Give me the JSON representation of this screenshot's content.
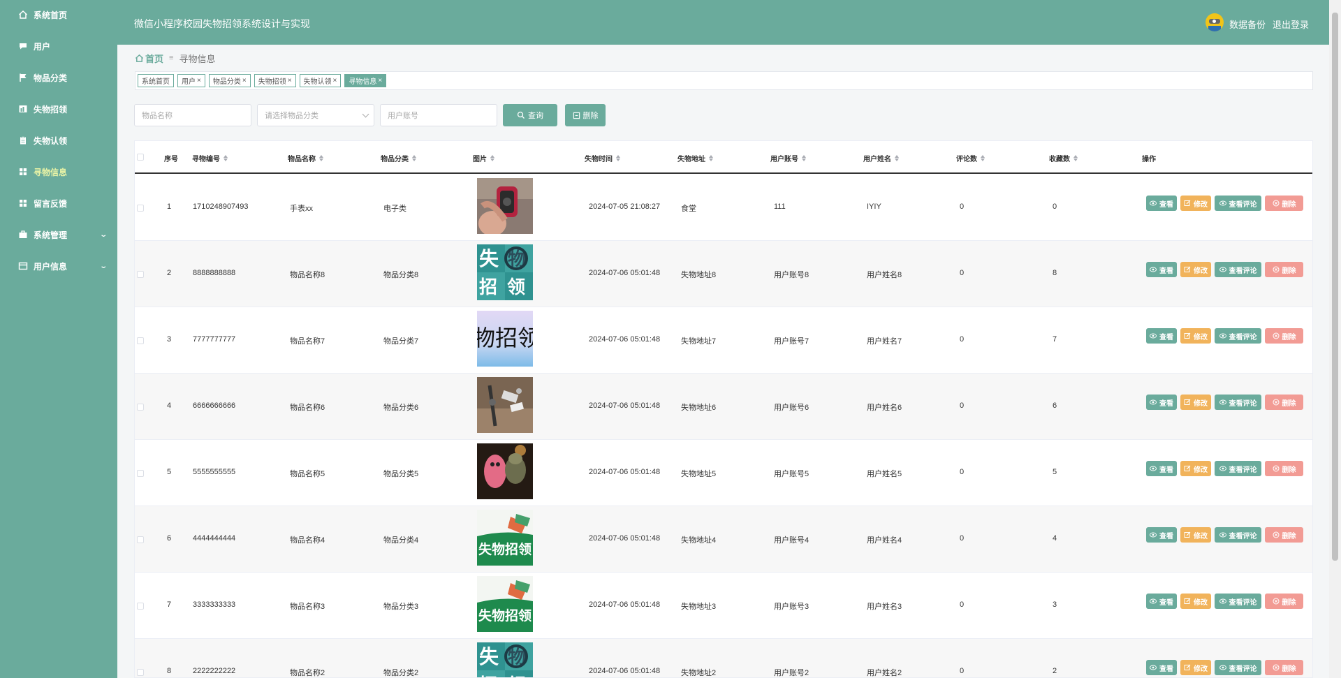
{
  "header": {
    "title": "微信小程序校园失物招领系统设计与实现",
    "backup_label": "数据备份",
    "logout_label": "退出登录"
  },
  "sidebar": {
    "items": [
      {
        "label": "系统首页",
        "icon": "home-icon"
      },
      {
        "label": "用户",
        "icon": "comment-icon"
      },
      {
        "label": "物品分类",
        "icon": "flag-icon"
      },
      {
        "label": "失物招领",
        "icon": "chart-icon"
      },
      {
        "label": "失物认领",
        "icon": "clipboard-icon"
      },
      {
        "label": "寻物信息",
        "icon": "grid-icon"
      },
      {
        "label": "留言反馈",
        "icon": "grid-icon"
      },
      {
        "label": "系统管理",
        "icon": "briefcase-icon"
      },
      {
        "label": "用户信息",
        "icon": "card-icon"
      }
    ]
  },
  "breadcrumb": {
    "home": "首页",
    "current": "寻物信息"
  },
  "tags": [
    {
      "label": "系统首页",
      "closable": false
    },
    {
      "label": "用户",
      "closable": true
    },
    {
      "label": "物品分类",
      "closable": true
    },
    {
      "label": "失物招领",
      "closable": true
    },
    {
      "label": "失物认领",
      "closable": true
    },
    {
      "label": "寻物信息",
      "closable": true
    }
  ],
  "search": {
    "name_placeholder": "物品名称",
    "category_placeholder": "请选择物品分类",
    "account_placeholder": "用户账号",
    "query_label": "查询",
    "delete_label": "删除"
  },
  "table": {
    "columns": [
      "序号",
      "寻物编号",
      "物品名称",
      "物品分类",
      "图片",
      "失物时间",
      "失物地址",
      "用户账号",
      "用户姓名",
      "评论数",
      "收藏数",
      "操作"
    ],
    "rows": [
      {
        "index": "1",
        "code": "1710248907493",
        "name": "手表xx",
        "category": "电子类",
        "time": "2024-07-05 21:08:27",
        "address": "食堂",
        "account": "111",
        "username": "IYIY",
        "comments": "0",
        "favorites": "0",
        "image": "watch"
      },
      {
        "index": "2",
        "code": "8888888888",
        "name": "物品名称8",
        "category": "物品分类8",
        "time": "2024-07-06 05:01:48",
        "address": "失物地址8",
        "account": "用户账号8",
        "username": "用户姓名8",
        "comments": "0",
        "favorites": "8",
        "image": "lost-found-teal"
      },
      {
        "index": "3",
        "code": "7777777777",
        "name": "物品名称7",
        "category": "物品分类7",
        "time": "2024-07-06 05:01:48",
        "address": "失物地址7",
        "account": "用户账号7",
        "username": "用户姓名7",
        "comments": "0",
        "favorites": "7",
        "image": "lost-found-text"
      },
      {
        "index": "4",
        "code": "6666666666",
        "name": "物品名称6",
        "category": "物品分类6",
        "time": "2024-07-06 05:01:48",
        "address": "失物地址6",
        "account": "用户账号6",
        "username": "用户姓名6",
        "comments": "0",
        "favorites": "6",
        "image": "keys"
      },
      {
        "index": "5",
        "code": "5555555555",
        "name": "物品名称5",
        "category": "物品分类5",
        "time": "2024-07-06 05:01:48",
        "address": "失物地址5",
        "account": "用户账号5",
        "username": "用户姓名5",
        "comments": "0",
        "favorites": "5",
        "image": "toys"
      },
      {
        "index": "6",
        "code": "4444444444",
        "name": "物品名称4",
        "category": "物品分类4",
        "time": "2024-07-06 05:01:48",
        "address": "失物地址4",
        "account": "用户账号4",
        "username": "用户姓名4",
        "comments": "0",
        "favorites": "4",
        "image": "lost-found-green"
      },
      {
        "index": "7",
        "code": "3333333333",
        "name": "物品名称3",
        "category": "物品分类3",
        "time": "2024-07-06 05:01:48",
        "address": "失物地址3",
        "account": "用户账号3",
        "username": "用户姓名3",
        "comments": "0",
        "favorites": "3",
        "image": "lost-found-green"
      },
      {
        "index": "8",
        "code": "2222222222",
        "name": "物品名称2",
        "category": "物品分类2",
        "time": "2024-07-06 05:01:48",
        "address": "失物地址2",
        "account": "用户账号2",
        "username": "用户姓名2",
        "comments": "0",
        "favorites": "2",
        "image": "lost-found-teal"
      }
    ],
    "actions": {
      "view": "查看",
      "edit": "修改",
      "comments": "查看评论",
      "delete": "删除"
    }
  },
  "colors": {
    "primary": "#6aab9c",
    "warning": "#f1b35b",
    "danger": "#f29b94"
  }
}
